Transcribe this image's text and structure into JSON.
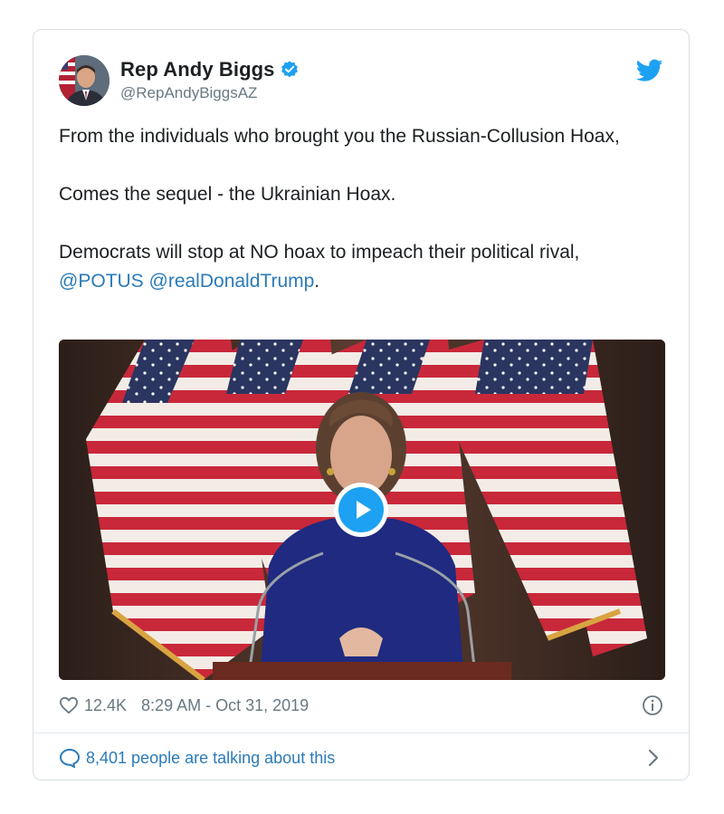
{
  "author": {
    "display_name": "Rep Andy Biggs",
    "handle": "@RepAndyBiggsAZ",
    "verified_icon": "verified-badge-icon",
    "avatar": "avatar-photo"
  },
  "brand": {
    "icon": "twitter-bird-icon",
    "color": "#1da1f2"
  },
  "tweet": {
    "line1": "From the individuals who brought you the Russian-Collusion Hoax,",
    "line2": "Comes the sequel - the Ukrainian Hoax.",
    "line3": "Democrats will stop at NO hoax to impeach their political rival,",
    "mention1": "@POTUS",
    "mention2": "@realDonaldTrump",
    "trailing": "."
  },
  "media": {
    "type": "video",
    "play_icon": "play-icon"
  },
  "meta": {
    "like_count": "12.4K",
    "timestamp": "8:29 AM - Oct 31, 2019",
    "heart_icon": "heart-icon",
    "info_icon": "info-icon"
  },
  "conversation": {
    "label": "8,401 people are talking about this",
    "bubble_icon": "speech-bubble-icon",
    "chevron_icon": "chevron-right-icon"
  },
  "colors": {
    "link": "#2b7bb9",
    "secondary_text": "#697882",
    "border": "#d8dfe4"
  }
}
